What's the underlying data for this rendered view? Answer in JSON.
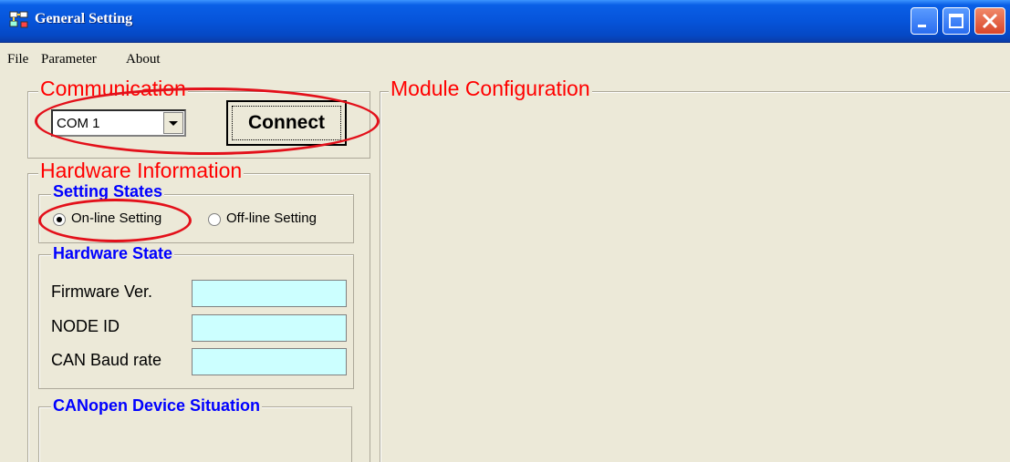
{
  "window": {
    "title": "General Setting"
  },
  "menu": [
    "File",
    "Parameter",
    "About"
  ],
  "communication": {
    "legend": "Communication",
    "port": "COM 1",
    "connect_label": "Connect"
  },
  "hardware_info": {
    "legend": "Hardware Information",
    "setting_states": {
      "legend": "Setting States",
      "online_label": "On-line Setting",
      "offline_label": "Off-line Setting",
      "selected": "On-line Setting"
    },
    "hardware_state": {
      "legend": "Hardware State",
      "fields": [
        {
          "label": "Firmware Ver.",
          "value": ""
        },
        {
          "label": "NODE ID",
          "value": ""
        },
        {
          "label": "CAN Baud rate",
          "value": ""
        }
      ]
    },
    "device_situation": {
      "legend": "CANopen Device Situation"
    }
  },
  "module_configuration": {
    "legend": "Module Configuration"
  },
  "colors": {
    "titlebar": "#0654da",
    "red_legend": "#ff0000",
    "blue_legend": "#0000ff",
    "textbox": "#ccffff",
    "highlight_ellipse": "#e3101a"
  }
}
